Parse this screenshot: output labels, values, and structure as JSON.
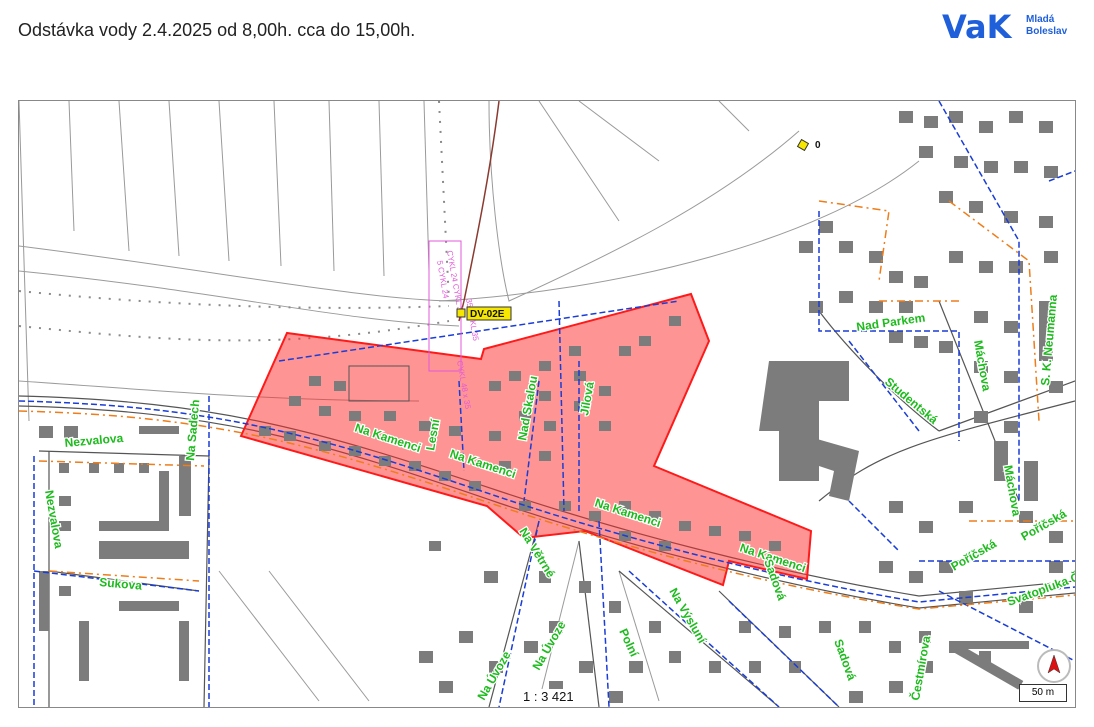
{
  "header": {
    "title": "Odstávka vody 2.4.2025  od 8,00h. cca do 15,00h.",
    "logo_main": "VaK",
    "logo_line1": "Mladá",
    "logo_line2": "Boleslav"
  },
  "map": {
    "scale_ratio": "1 : 3 421",
    "scalebar_label": "50 m",
    "outage_area_color": "#ff2a2a",
    "water_main_color": "#1a3dd6",
    "sewer_color": "#ee7d1a",
    "street_label_color": "#1dbb1d",
    "streets": [
      "Nezvalova",
      "Nezvalova",
      "Na Kamenci",
      "Na Kamenci",
      "Na Kamenci",
      "Na Kamenci",
      "Lesní",
      "Nad Skalou",
      "Jílová",
      "Nad Parkem",
      "Studentská",
      "Máchova",
      "S. K. Neumanna",
      "Máchova",
      "Poříčská",
      "Poříčská",
      "Sukova",
      "Na Sadech",
      "Na Výsluní",
      "Na Větrné",
      "Polní",
      "Na Úvoze",
      "Na Úvoze",
      "Sadová",
      "Sadová",
      "Svatopluka Čecha",
      "Čestmírova"
    ],
    "markers": [
      {
        "label": "DV-02E"
      },
      {
        "label": "0"
      }
    ],
    "annotations": [
      "5 CYKL 24",
      "CYKL 24 CYKL 35",
      "35 CYKL 35",
      "CYKL 48 x 35"
    ]
  }
}
